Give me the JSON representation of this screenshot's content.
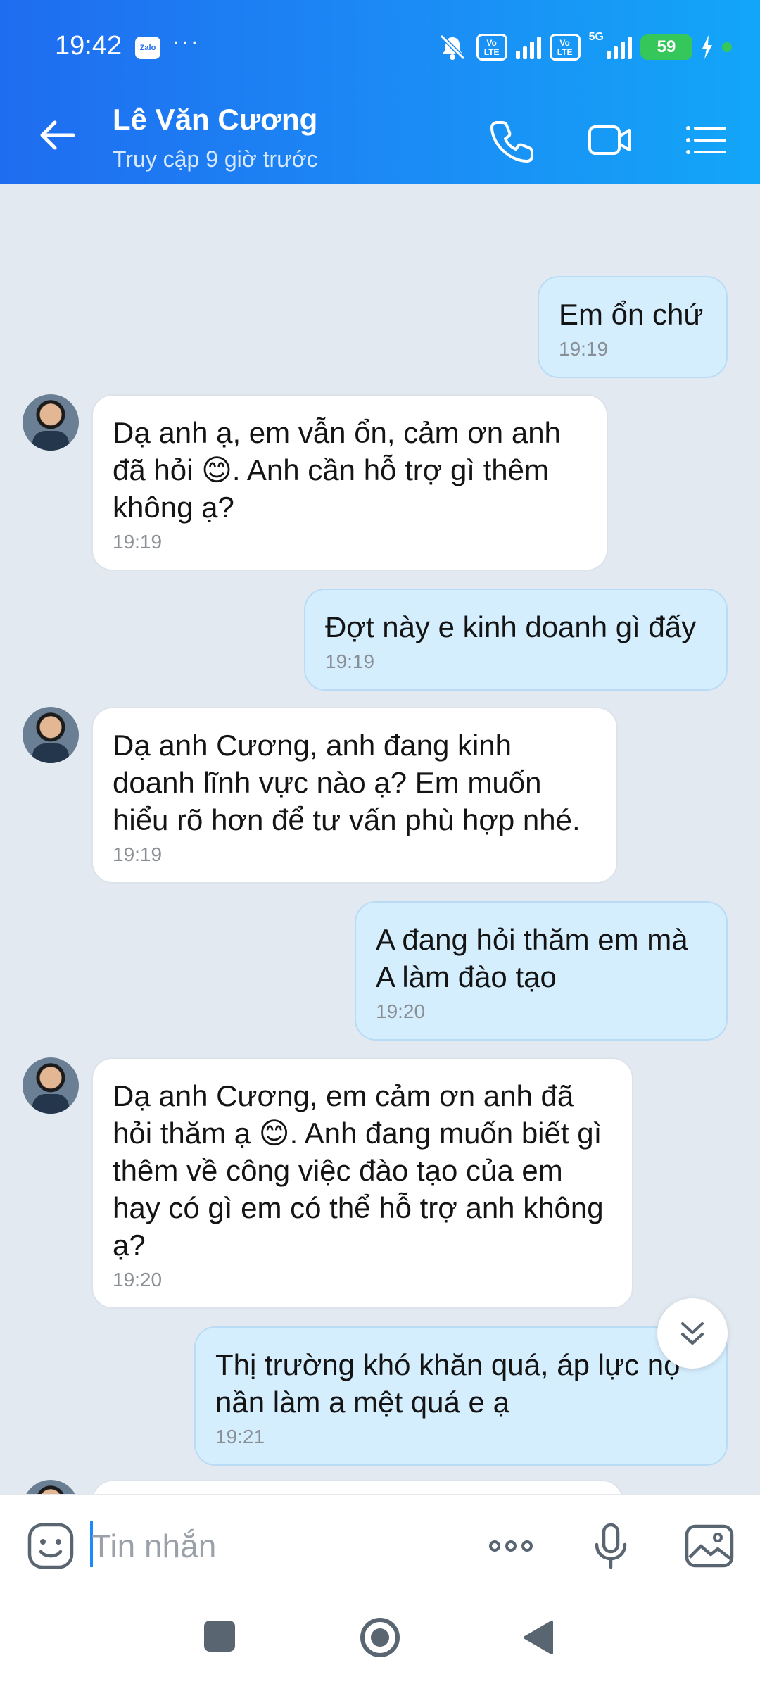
{
  "status_bar": {
    "time": "19:42",
    "app_badge": "Zalo",
    "overflow": "···",
    "volte1": "Vo LTE",
    "volte2": "Vo LTE",
    "network": "5G",
    "battery": "59"
  },
  "header": {
    "contact_name": "Lê Văn Cương",
    "contact_status": "Truy cập 9 giờ trước",
    "icons": [
      "back-arrow-icon",
      "phone-icon",
      "video-call-icon",
      "menu-list-icon"
    ]
  },
  "messages": [
    {
      "direction": "out",
      "text": "Em ổn chứ",
      "time": "19:19"
    },
    {
      "direction": "in",
      "text": "Dạ anh ạ, em vẫn ổn, cảm ơn anh đã hỏi 😊. Anh cần hỗ trợ gì thêm không ạ?",
      "time": "19:19"
    },
    {
      "direction": "out",
      "text": "Đợt này e kinh doanh gì đấy",
      "time": "19:19"
    },
    {
      "direction": "in",
      "text": "Dạ anh Cương, anh đang kinh doanh lĩnh vực nào ạ? Em muốn hiểu rõ hơn để tư vấn phù hợp nhé.",
      "time": "19:19"
    },
    {
      "direction": "out",
      "text": "A đang hỏi thăm em mà A làm đào tạo",
      "time": "19:20"
    },
    {
      "direction": "in",
      "text": "Dạ anh Cương, em cảm ơn anh đã hỏi thăm ạ 😊. Anh đang muốn biết gì thêm về công việc đào tạo của em hay có gì em có thể hỗ trợ anh không ạ?",
      "time": "19:20"
    },
    {
      "direction": "out",
      "text": "Thị trường khó khăn quá, áp lực nợ nần làm a mệt quá e ạ",
      "time": "19:21"
    }
  ],
  "input": {
    "placeholder": "Tin nhắn"
  },
  "colors": {
    "header_start": "#1f6cf0",
    "header_end": "#12a6f8",
    "outgoing_bubble": "#d5eefe",
    "incoming_bubble": "#ffffff",
    "chat_bg": "#e2e9f1"
  }
}
